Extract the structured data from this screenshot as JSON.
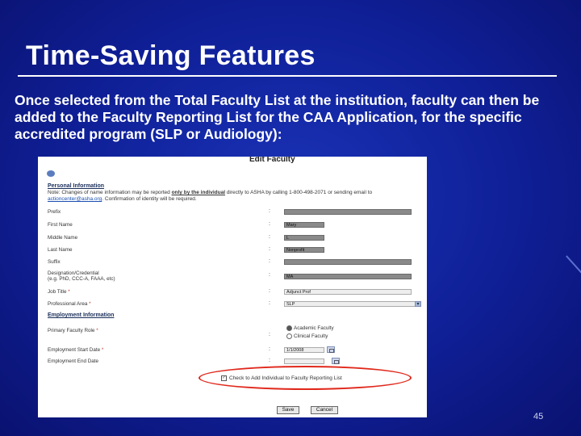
{
  "slide": {
    "title": "Time-Saving Features",
    "intro": "Once selected from the Total Faculty List at the institution, faculty can then be added to the Faculty Reporting List for the CAA Application, for the specific accredited program (SLP or Audiology):",
    "page_number": "45"
  },
  "form": {
    "header": "Edit Faculty",
    "personal_section": "Personal Information",
    "note_pre": "Note: Changes of name information may be reported ",
    "note_bold": "only by the individual",
    "note_mid": " directly to ASHA by calling 1-800-498-2071 or sending email to ",
    "note_link": "actioncenter@asha.org",
    "note_post": ". Confirmation of identity will be required.",
    "fields": {
      "prefix_label": "Prefix",
      "first_name_label": "First Name",
      "first_name_value": "Mary",
      "middle_name_label": "Middle Name",
      "middle_name_value": "L",
      "last_name_label": "Last Name",
      "last_name_value": "Nonprofit",
      "suffix_label": "Suffix",
      "designation_label": "Designation/Credential",
      "designation_hint": "(e.g. PhD, CCC-A, FAAA, etc)",
      "designation_value": "MA",
      "job_title_label": "Job Title",
      "job_title_value": "Adjunct Prof",
      "professional_area_label": "Professional Area",
      "professional_area_value": "SLP"
    },
    "employment_section": "Employment Information",
    "primary_role_label": "Primary Faculty Role",
    "role_options": [
      "Academic Faculty",
      "Clinical Faculty"
    ],
    "start_date_label": "Employment Start Date",
    "start_date_value": "1/1/2008",
    "end_date_label": "Employment End Date",
    "required_mark": "*",
    "colon": ":",
    "checkbox_check": "✓",
    "select_arrow": "▾",
    "checkbox_label": "Check to Add Individual to Faculty Reporting List",
    "save_label": "Save",
    "cancel_label": "Cancel"
  }
}
